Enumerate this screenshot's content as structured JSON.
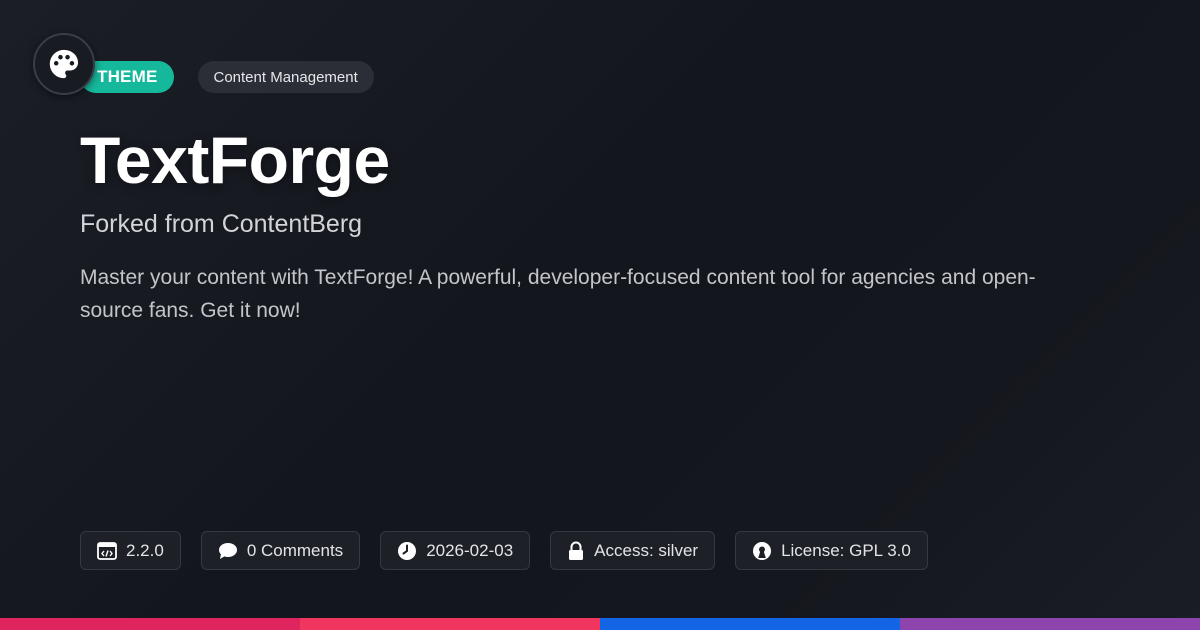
{
  "logo": {
    "icon": "palette-icon"
  },
  "tags": {
    "type": "THEME",
    "category": "Content Management"
  },
  "title": "TextForge",
  "subtitle": "Forked from ContentBerg",
  "description": "Master your content with TextForge! A powerful, developer-focused content tool for agencies and open-source fans. Get it now!",
  "meta": {
    "version": "2.2.0",
    "comments": "0 Comments",
    "date": "2026-02-03",
    "access": "Access: silver",
    "license": "License: GPL 3.0"
  },
  "colors": {
    "accent": "#16b89c",
    "bar_colors": [
      "#e0245e",
      "#f0365e",
      "#1464e6",
      "#8e44ad"
    ]
  }
}
